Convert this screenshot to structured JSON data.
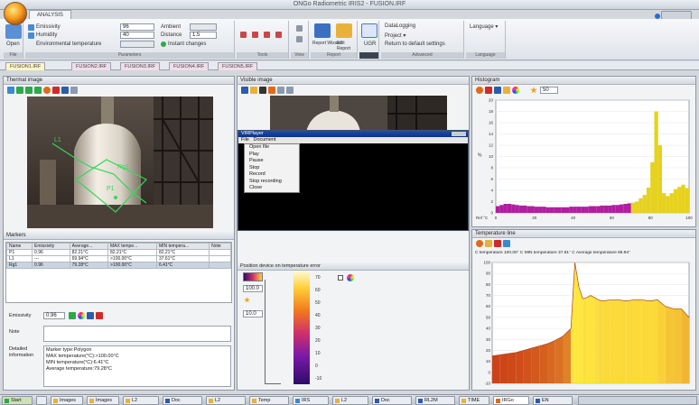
{
  "app": {
    "title": "ONGo Radiometric IRIS2 - FUSION.IRF",
    "ribbon_tab": "ANALYSIS"
  },
  "ribbon": {
    "emissivity_label": "Emissivity",
    "emissivity_value": "96",
    "humidity_label": "Humidity",
    "humidity_value": "40",
    "env_temp_label": "Environmental temperature",
    "ambient_label": "Ambient",
    "distance_label": "Distance",
    "distance_value": "1.5",
    "instant_changes_label": "Instant changes",
    "report_wizard_label": "Report Wizard",
    "edit_report_label": "Edit Report",
    "ugr_label": "UGR",
    "datalogging_label": "DataLogging",
    "project_label": "Project ▾",
    "return_defaults_label": "Return to default settings",
    "language_label": "Language ▾",
    "group_labels": [
      "File",
      "Parameters",
      "Tools",
      "View",
      "Report",
      "",
      "Advanced",
      "Language"
    ]
  },
  "file_tabs": [
    "FUSION1.IRF",
    "FUSION2.IRF",
    "FUSION3.IRF",
    "FUSION4.IRF",
    "FUSION5.IRF"
  ],
  "thermal_panel": {
    "title": "Thermal image",
    "markers_title": "Markers",
    "columns": [
      "Name",
      "Emissivity",
      "Average...",
      "MAX tempe...",
      "MIN tempera...",
      "Note"
    ],
    "rows": [
      [
        "P1",
        "0.96",
        "82.21°C",
        "82.21°C",
        "82.21°C",
        ""
      ],
      [
        "L1",
        "---",
        "69.94°C",
        ">100.00°C",
        "37.61°C",
        ""
      ],
      [
        "Rg1",
        "0.96",
        "79.28°C",
        ">100.00°C",
        "6.41°C",
        ""
      ]
    ],
    "emissivity_label": "Emissivity",
    "emissivity_value": "0.96",
    "note_label": "Note",
    "detailed_label": "Detailed information",
    "detailed_lines": [
      "Marker type:Polygon",
      "MAX temperature(°C):>100.00°C",
      "MIN temperature(°C):6.41°C",
      "Average temperature:79.28°C"
    ]
  },
  "visible_panel": {
    "title": "Visible image",
    "player_title": "VIRPlayer",
    "player_menu": [
      "File",
      "Document"
    ],
    "player_items": [
      "Open file",
      "Play",
      "Pause",
      "Stop",
      "Record",
      "Stop recording",
      "Close"
    ],
    "palette_title": "Position device on temperature error",
    "palette_high": "100.0",
    "palette_low": "10.0",
    "scale": [
      "70",
      "60",
      "50",
      "40",
      "30",
      "20",
      "10",
      "0",
      "-10"
    ]
  },
  "histogram_panel": {
    "title": "Histogram",
    "zoom_value": "50",
    "x_label": "Ref °C",
    "y_label": "%"
  },
  "templine_panel": {
    "title": "Temperature line",
    "summary": "C temperature 100.00° C MIN temperature 37.61° C Average temperature 69.94°"
  },
  "colors": {
    "accent": "#f0a020",
    "hist_bar": "#e6d21e",
    "hist_low": "#b01e9e"
  },
  "chart_data": [
    {
      "type": "bar",
      "title": "Histogram",
      "xlabel": "Ref °C",
      "ylabel": "%",
      "xlim": [
        0,
        100
      ],
      "ylim": [
        0,
        20
      ],
      "x_ticks": [
        0,
        20,
        40,
        60,
        80,
        100
      ],
      "y_ticks": [
        0,
        2,
        4,
        6,
        8,
        10,
        12,
        14,
        16,
        18,
        20
      ],
      "x": [
        1,
        3,
        5,
        7,
        9,
        11,
        13,
        15,
        17,
        19,
        21,
        23,
        25,
        27,
        29,
        31,
        33,
        35,
        37,
        39,
        41,
        43,
        45,
        47,
        49,
        51,
        53,
        55,
        57,
        59,
        61,
        63,
        65,
        67,
        69,
        71,
        73,
        75,
        77,
        79,
        81,
        83,
        85,
        87,
        89,
        91,
        93,
        95,
        97,
        99
      ],
      "values": [
        1.2,
        1.4,
        1.6,
        1.6,
        1.5,
        1.4,
        1.3,
        1.3,
        1.2,
        1.2,
        1.1,
        1.1,
        1.1,
        1.0,
        1.0,
        1.0,
        1.0,
        1.0,
        1.0,
        1.1,
        1.1,
        1.1,
        1.1,
        1.1,
        1.2,
        1.2,
        1.2,
        1.3,
        1.3,
        1.3,
        1.4,
        1.4,
        1.5,
        1.6,
        1.7,
        1.8,
        2.0,
        2.6,
        3.2,
        4.5,
        9.0,
        18.0,
        12.0,
        3.5,
        3.0,
        3.5,
        4.2,
        4.6,
        5.0,
        4.4
      ]
    },
    {
      "type": "area",
      "title": "Temperature line",
      "xlim": [
        0,
        100
      ],
      "ylim": [
        -10,
        100
      ],
      "y_ticks": [
        -10,
        0,
        10,
        20,
        30,
        40,
        50,
        60,
        70,
        80,
        90,
        100
      ],
      "x": [
        0,
        4,
        8,
        12,
        16,
        20,
        24,
        28,
        32,
        36,
        40,
        42,
        44,
        46,
        48,
        50,
        52,
        54,
        56,
        60,
        64,
        68,
        72,
        76,
        80,
        84,
        88,
        92,
        96,
        100
      ],
      "values": [
        15,
        16,
        17,
        18,
        20,
        22,
        24,
        26,
        29,
        33,
        40,
        100,
        78,
        67,
        68,
        70,
        68,
        66,
        65,
        66,
        66,
        65,
        66,
        66,
        65,
        66,
        60,
        58,
        58,
        50
      ]
    }
  ]
}
